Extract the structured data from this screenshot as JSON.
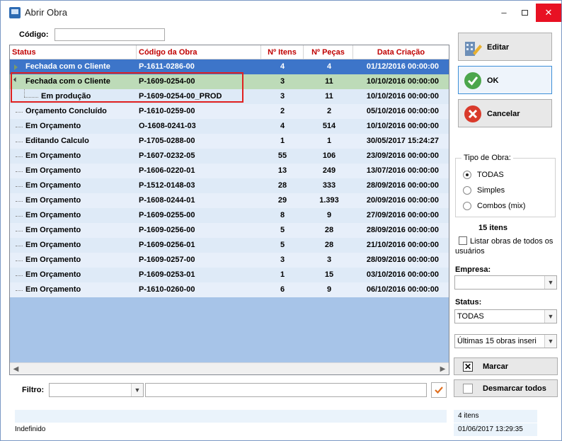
{
  "window": {
    "title": "Abrir Obra",
    "minimize_label": "–",
    "close_label": "✕"
  },
  "search": {
    "codigo_label": "Código:",
    "codigo_value": ""
  },
  "grid": {
    "columns": [
      "Status",
      "Código da Obra",
      "Nº Itens",
      "Nº Peças",
      "Data Criação"
    ],
    "rows": [
      {
        "status": "Fechada com o Cliente",
        "codigo": "P-1611-0286-00",
        "itens": "4",
        "pecas": "4",
        "data": "01/12/2016  00:00:00"
      },
      {
        "status": "Fechada com o Cliente",
        "codigo": "P-1609-0254-00",
        "itens": "3",
        "pecas": "11",
        "data": "10/10/2016  00:00:00"
      },
      {
        "status": "Em produção",
        "codigo": "P-1609-0254-00_PROD",
        "itens": "3",
        "pecas": "11",
        "data": "10/10/2016  00:00:00"
      },
      {
        "status": "Orçamento Concluído",
        "codigo": "P-1610-0259-00",
        "itens": "2",
        "pecas": "2",
        "data": "05/10/2016  00:00:00"
      },
      {
        "status": "Em Orçamento",
        "codigo": "O-1608-0241-03",
        "itens": "4",
        "pecas": "514",
        "data": "10/10/2016  00:00:00"
      },
      {
        "status": "Editando Calculo",
        "codigo": "P-1705-0288-00",
        "itens": "1",
        "pecas": "1",
        "data": "30/05/2017  15:24:27"
      },
      {
        "status": "Em Orçamento",
        "codigo": "P-1607-0232-05",
        "itens": "55",
        "pecas": "106",
        "data": "23/09/2016  00:00:00"
      },
      {
        "status": "Em Orçamento",
        "codigo": "P-1606-0220-01",
        "itens": "13",
        "pecas": "249",
        "data": "13/07/2016  00:00:00"
      },
      {
        "status": "Em Orçamento",
        "codigo": "P-1512-0148-03",
        "itens": "28",
        "pecas": "333",
        "data": "28/09/2016  00:00:00"
      },
      {
        "status": "Em Orçamento",
        "codigo": "P-1608-0244-01",
        "itens": "29",
        "pecas": "1.393",
        "data": "20/09/2016  00:00:00"
      },
      {
        "status": "Em Orçamento",
        "codigo": "P-1609-0255-00",
        "itens": "8",
        "pecas": "9",
        "data": "27/09/2016  00:00:00"
      },
      {
        "status": "Em Orçamento",
        "codigo": "P-1609-0256-00",
        "itens": "5",
        "pecas": "28",
        "data": "28/09/2016  00:00:00"
      },
      {
        "status": "Em Orçamento",
        "codigo": "P-1609-0256-01",
        "itens": "5",
        "pecas": "28",
        "data": "21/10/2016  00:00:00"
      },
      {
        "status": "Em Orçamento",
        "codigo": "P-1609-0257-00",
        "itens": "3",
        "pecas": "3",
        "data": "28/09/2016  00:00:00"
      },
      {
        "status": "Em Orçamento",
        "codigo": "P-1609-0253-01",
        "itens": "1",
        "pecas": "15",
        "data": "03/10/2016  00:00:00"
      },
      {
        "status": "Em Orçamento",
        "codigo": "P-1610-0260-00",
        "itens": "6",
        "pecas": "9",
        "data": "06/10/2016  00:00:00"
      }
    ]
  },
  "filter": {
    "label": "Filtro:",
    "column_value": "",
    "text_value": ""
  },
  "actions": {
    "editar": "Editar",
    "ok": "OK",
    "cancelar": "Cancelar"
  },
  "tipo_obra": {
    "title": "Tipo de Obra:",
    "options": [
      "TODAS",
      "Simples",
      "Combos (mix)"
    ],
    "selected": "TODAS"
  },
  "count_label": "15 itens",
  "listar_todos": "Listar obras de todos os usuários",
  "empresa": {
    "label": "Empresa:",
    "value": ""
  },
  "status_filter": {
    "label": "Status:",
    "value": "TODAS"
  },
  "ultimas": {
    "value": "Últimas 15 obras inseri"
  },
  "marcar": "Marcar",
  "desmarcar": "Desmarcar todos",
  "footer": {
    "status_left": "Indefinido",
    "items": "4 itens",
    "datetime": "01/06/2017 13:29:35"
  },
  "colors": {
    "selected_row": "#3d75c9",
    "expanded_row": "#bddbb8",
    "header_text": "#c00000",
    "highlight_box": "#e02020"
  }
}
